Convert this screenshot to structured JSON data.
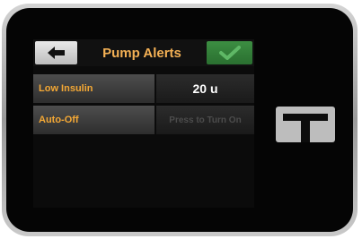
{
  "header": {
    "title": "Pump Alerts",
    "back_icon": "arrow-left-icon",
    "confirm_icon": "checkmark-icon"
  },
  "settings": [
    {
      "label": "Low Insulin",
      "value": "20 u"
    },
    {
      "label": "Auto-Off",
      "value": "Press to Turn On"
    }
  ],
  "colors": {
    "accent": "#f4b155",
    "confirm_green": "#2e7d32",
    "screen_background": "#0b0b0b"
  }
}
